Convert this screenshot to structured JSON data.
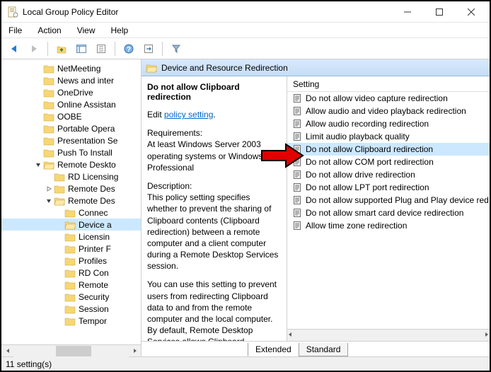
{
  "window": {
    "title": "Local Group Policy Editor"
  },
  "menubar": [
    "File",
    "Action",
    "View",
    "Help"
  ],
  "tree": [
    {
      "depth": 3,
      "tw": "",
      "label": "NetMeeting"
    },
    {
      "depth": 3,
      "tw": "",
      "label": "News and inter"
    },
    {
      "depth": 3,
      "tw": "",
      "label": "OneDrive"
    },
    {
      "depth": 3,
      "tw": "",
      "label": "Online Assistan"
    },
    {
      "depth": 3,
      "tw": "",
      "label": "OOBE"
    },
    {
      "depth": 3,
      "tw": "",
      "label": "Portable Opera"
    },
    {
      "depth": 3,
      "tw": "",
      "label": "Presentation Se"
    },
    {
      "depth": 3,
      "tw": "",
      "label": "Push To Install"
    },
    {
      "depth": 3,
      "tw": "v",
      "label": "Remote Deskto",
      "expanded": true
    },
    {
      "depth": 4,
      "tw": "",
      "label": "RD Licensing"
    },
    {
      "depth": 4,
      "tw": ">",
      "label": "Remote Des"
    },
    {
      "depth": 4,
      "tw": "v",
      "label": "Remote Des",
      "expanded": true
    },
    {
      "depth": 5,
      "tw": "",
      "label": "Connec"
    },
    {
      "depth": 5,
      "tw": "",
      "label": "Device a",
      "selected": true
    },
    {
      "depth": 5,
      "tw": "",
      "label": "Licensin"
    },
    {
      "depth": 5,
      "tw": "",
      "label": "Printer F"
    },
    {
      "depth": 5,
      "tw": "",
      "label": "Profiles"
    },
    {
      "depth": 5,
      "tw": "",
      "label": "RD Con"
    },
    {
      "depth": 5,
      "tw": "",
      "label": "Remote"
    },
    {
      "depth": 5,
      "tw": "",
      "label": "Security"
    },
    {
      "depth": 5,
      "tw": "",
      "label": "Session"
    },
    {
      "depth": 5,
      "tw": "",
      "label": "Tempor"
    }
  ],
  "header": {
    "title": "Device and Resource Redirection"
  },
  "details": {
    "title": "Do not allow Clipboard redirection",
    "edit_prefix": "Edit ",
    "edit_link": "policy setting",
    "req_label": "Requirements:",
    "req_text": "At least Windows Server 2003 operating systems or Windows XP Professional",
    "desc_label": "Description:",
    "desc1": "This policy setting specifies whether to prevent the sharing of Clipboard contents (Clipboard redirection) between a remote computer and a client computer during a Remote Desktop Services session.",
    "desc2": "You can use this setting to prevent users from redirecting Clipboard data to and from the remote computer and the local computer. By default, Remote Desktop Services allows Clipboard"
  },
  "list": {
    "header": "Setting",
    "items": [
      {
        "label": "Do not allow video capture redirection"
      },
      {
        "label": "Allow audio and video playback redirection"
      },
      {
        "label": "Allow audio recording redirection"
      },
      {
        "label": "Limit audio playback quality"
      },
      {
        "label": "Do not allow Clipboard redirection",
        "selected": true
      },
      {
        "label": "Do not allow COM port redirection"
      },
      {
        "label": "Do not allow drive redirection"
      },
      {
        "label": "Do not allow LPT port redirection"
      },
      {
        "label": "Do not allow supported Plug and Play device red"
      },
      {
        "label": "Do not allow smart card device redirection"
      },
      {
        "label": "Allow time zone redirection"
      }
    ]
  },
  "tabs": {
    "extended": "Extended",
    "standard": "Standard"
  },
  "status": "11 setting(s)"
}
